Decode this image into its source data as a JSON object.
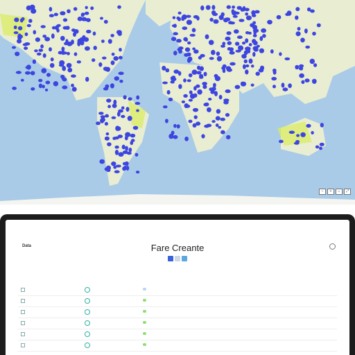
{
  "map": {
    "labels": {
      "l1": "",
      "l2": "",
      "l3": "",
      "l4": "",
      "l5": ""
    },
    "controls": [
      "–",
      "+",
      "⌂",
      "⤢"
    ],
    "footer": {
      "left": "",
      "middle": "",
      "right": ""
    },
    "colors": {
      "ocean": "#a9cbe8",
      "land": "#e9edd2",
      "marker": "#3d45e0"
    }
  },
  "app": {
    "title": "Fare Creante",
    "topleft": "Data",
    "menu_icon": "more-icon",
    "toolbar_icons": [
      "grid-icon",
      "filter-icon",
      "export-icon"
    ]
  },
  "table": {
    "columns": [
      "",
      "",
      "",
      "",
      "",
      "",
      "",
      "",
      ""
    ],
    "rows": [
      {
        "c1": "",
        "c2": "",
        "c3": "",
        "c4": "",
        "c5": "",
        "c6": "",
        "c7": "",
        "c8": "",
        "dot": "#b7d6f2"
      },
      {
        "c1": "",
        "c2": "",
        "c3": "",
        "c4": "",
        "c5": "",
        "c6": "",
        "c7": "",
        "c8": "",
        "dot": "#8fe06f"
      },
      {
        "c1": "",
        "c2": "",
        "c3": "",
        "c4": "",
        "c5": "",
        "c6": "",
        "c7": "",
        "c8": "",
        "dot": "#8fe06f"
      },
      {
        "c1": "",
        "c2": "",
        "c3": "",
        "c4": "",
        "c5": "",
        "c6": "",
        "c7": "",
        "c8": "",
        "dot": "#8fe06f"
      },
      {
        "c1": "",
        "c2": "",
        "c3": "",
        "c4": "",
        "c5": "",
        "c6": "",
        "c7": "",
        "c8": "",
        "dot": "#8fe06f"
      },
      {
        "c1": "",
        "c2": "",
        "c3": "",
        "c4": "",
        "c5": "",
        "c6": "",
        "c7": "",
        "c8": "",
        "dot": "#8fe06f"
      }
    ]
  }
}
